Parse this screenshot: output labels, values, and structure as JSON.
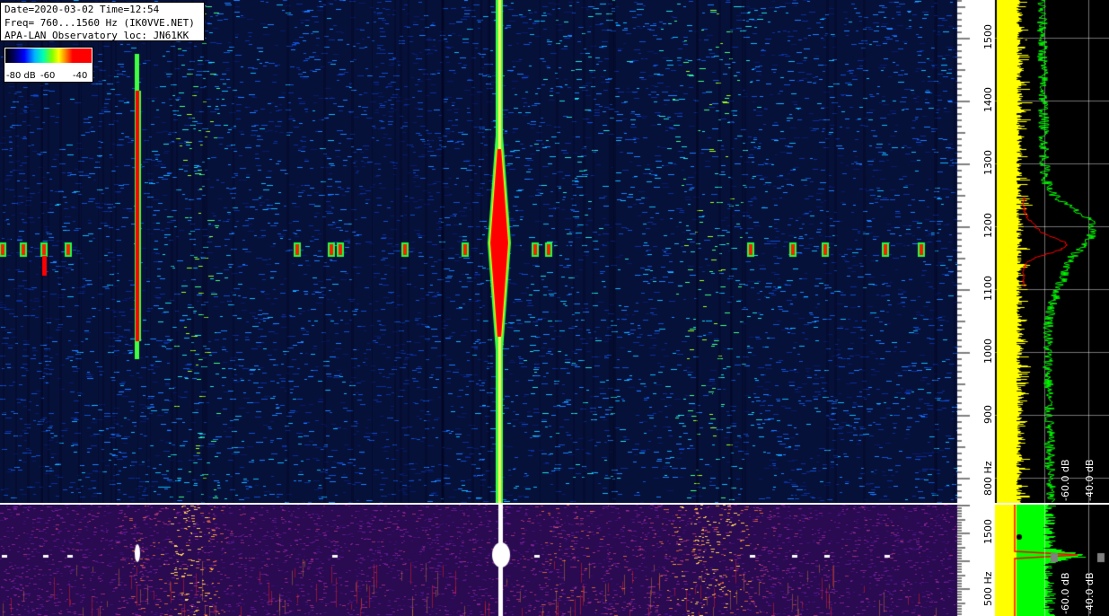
{
  "info": {
    "line1": "Date=2020-03-02 Time=12:54",
    "line2": "Freq= 760...1560 Hz (IK0VVE.NET)",
    "line3": "APA-LAN Observatory loc: JN61KK"
  },
  "legend": {
    "min_label": "-80 dB",
    "mid_label": "-60",
    "max_label": "-40",
    "colors": [
      "#000000",
      "#0000ff",
      "#00b4ff",
      "#00ffb0",
      "#80ff00",
      "#ffff00",
      "#ff8000",
      "#ff0000"
    ]
  },
  "top_scale": {
    "freq_min": 760,
    "freq_max": 1560,
    "ticks": [
      "1500",
      "1400",
      "1300",
      "1200",
      "1100",
      "1000",
      "900",
      "800 Hz"
    ],
    "tick_values": [
      1500,
      1400,
      1300,
      1200,
      1100,
      1000,
      900,
      800
    ],
    "db_labels": [
      "-40.0 dB",
      "-60.0 dB"
    ]
  },
  "bottom_scale": {
    "freq_min": 0,
    "freq_max": 2000,
    "ticks": [
      "1500",
      "500 Hz"
    ],
    "tick_values": [
      1500,
      500
    ],
    "db_labels": [
      "-40.0 dB",
      "-60.0 dB"
    ]
  },
  "colors": {
    "waterfall_background": "#0a1c5a",
    "signal_red": "#ff0000",
    "signal_green": "#20ff40",
    "spectrum_yellow": "#ffff00",
    "spectrum_green": "#00ff00",
    "spectrum_red": "#ff0000",
    "scale_background": "#ffffff",
    "bottom_background": "#3a0c5a",
    "bottom_band": "#ffb020"
  }
}
